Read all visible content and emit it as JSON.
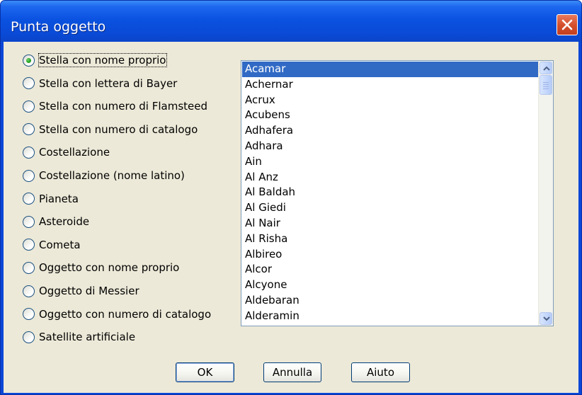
{
  "window": {
    "title": "Punta oggetto"
  },
  "radio_options": [
    {
      "label": "Stella con nome proprio",
      "checked": true
    },
    {
      "label": "Stella con lettera di Bayer",
      "checked": false
    },
    {
      "label": "Stella con numero di Flamsteed",
      "checked": false
    },
    {
      "label": "Stella con numero di catalogo",
      "checked": false
    },
    {
      "label": "Costellazione",
      "checked": false
    },
    {
      "label": "Costellazione (nome latino)",
      "checked": false
    },
    {
      "label": "Pianeta",
      "checked": false
    },
    {
      "label": "Asteroide",
      "checked": false
    },
    {
      "label": "Cometa",
      "checked": false
    },
    {
      "label": "Oggetto con nome proprio",
      "checked": false
    },
    {
      "label": "Oggetto di Messier",
      "checked": false
    },
    {
      "label": "Oggetto con numero di catalogo",
      "checked": false
    },
    {
      "label": "Satellite artificiale",
      "checked": false
    }
  ],
  "object_list": {
    "selected": "Acamar",
    "items": [
      "Acamar",
      "Achernar",
      "Acrux",
      "Acubens",
      "Adhafera",
      "Adhara",
      "Ain",
      "Al Anz",
      "Al Baldah",
      "Al Giedi",
      "Al Nair",
      "Al Risha",
      "Albireo",
      "Alcor",
      "Alcyone",
      "Aldebaran",
      "Alderamin"
    ]
  },
  "buttons": {
    "ok": "OK",
    "cancel": "Annulla",
    "help": "Aiuto"
  },
  "colors": {
    "title_bar": "#0a52e0",
    "selection": "#316ac5",
    "dialog_face": "#ece9d8",
    "close_button": "#d5502d"
  },
  "icons": {
    "close": "close-icon",
    "scroll_up": "chevron-up-icon",
    "scroll_down": "chevron-down-icon"
  }
}
